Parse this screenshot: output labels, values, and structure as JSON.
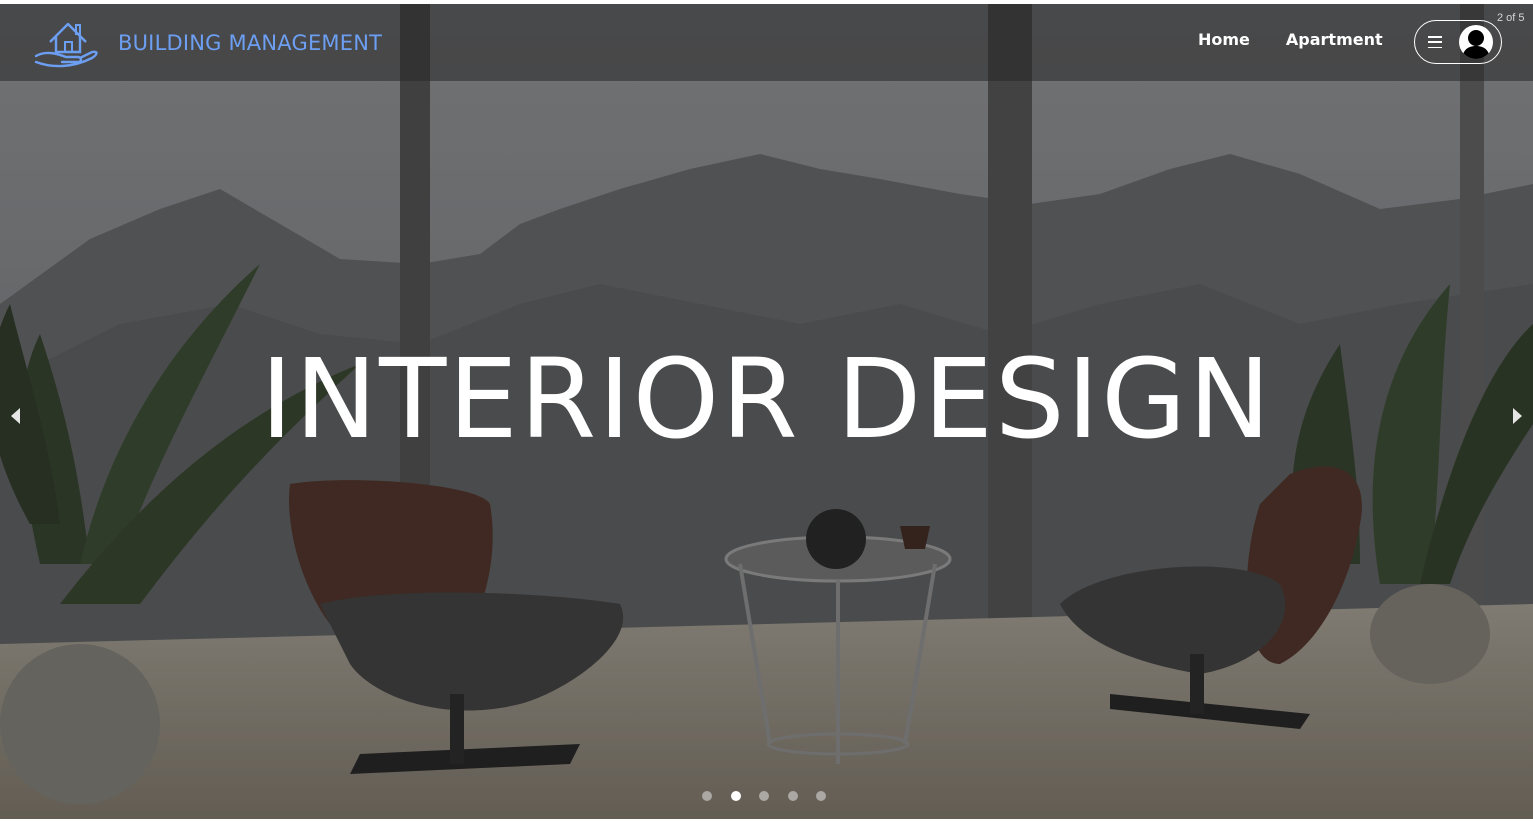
{
  "brand": {
    "name": "BUILDING MANAGEMENT",
    "logo_icon": "house-on-hand-icon",
    "color": "#6c9ef2"
  },
  "nav": {
    "items": [
      {
        "label": "Home"
      },
      {
        "label": "Apartment"
      }
    ]
  },
  "user_menu": {
    "menu_icon": "hamburger-icon",
    "avatar_icon": "user-avatar-icon"
  },
  "carousel": {
    "counter": "2 of 5",
    "title": "INTERIOR DESIGN",
    "current_slide": 2,
    "total_slides": 5,
    "prev_icon": "chevron-left-icon",
    "next_icon": "chevron-right-icon"
  },
  "colors": {
    "navbar_bg": "rgba(40,40,40,0.55)",
    "text": "#ffffff"
  }
}
